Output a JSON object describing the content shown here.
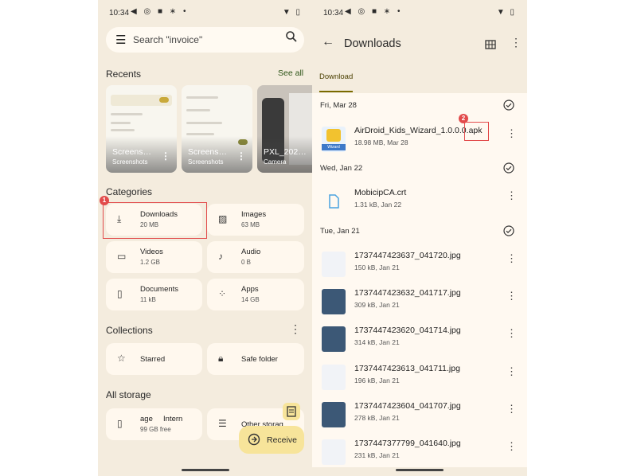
{
  "left": {
    "status": {
      "time": "10:34"
    },
    "search": {
      "placeholder": "Search \"invoice\""
    },
    "recents": {
      "title": "Recents",
      "see_all": "See all",
      "items": [
        {
          "label": "Screens…",
          "sublabel": "Screenshots"
        },
        {
          "label": "Screens…",
          "sublabel": "Screenshots"
        },
        {
          "label": "PXL_202…",
          "sublabel": "Camera"
        }
      ]
    },
    "categories": {
      "title": "Categories",
      "items": [
        {
          "name": "Downloads",
          "size": "20 MB",
          "icon": "download-icon"
        },
        {
          "name": "Images",
          "size": "63 MB",
          "icon": "image-icon"
        },
        {
          "name": "Videos",
          "size": "1.2 GB",
          "icon": "video-icon"
        },
        {
          "name": "Audio",
          "size": "0 B",
          "icon": "music-note-icon"
        },
        {
          "name": "Documents",
          "size": "11 kB",
          "icon": "document-icon"
        },
        {
          "name": "Apps",
          "size": "14 GB",
          "icon": "apps-grid-icon"
        }
      ]
    },
    "collections": {
      "title": "Collections",
      "items": [
        {
          "name": "Starred",
          "icon": "star-icon"
        },
        {
          "name": "Safe folder",
          "icon": "lock-icon"
        }
      ]
    },
    "storage": {
      "title": "All storage",
      "items": [
        {
          "name": "age     Intern",
          "sub": "99 GB free",
          "icon": "phone-icon"
        },
        {
          "name": "Other storag",
          "icon": "list-icon"
        }
      ]
    },
    "receive_label": "Receive",
    "callout_number": "1"
  },
  "right": {
    "status": {
      "time": "10:34"
    },
    "title": "Downloads",
    "tab": "Download",
    "callout_number": "2",
    "groups": [
      {
        "date": "Fri, Mar 28",
        "files": [
          {
            "name": "AirDroid_Kids_Wizard_1.0.0.0.apk",
            "meta": "18.98 MB, Mar 28",
            "kind": "apk",
            "icon_text": "Wizard"
          }
        ]
      },
      {
        "date": "Wed, Jan 22",
        "files": [
          {
            "name": "MobicipCA.crt",
            "meta": "1.31 kB, Jan 22",
            "kind": "cert"
          }
        ]
      },
      {
        "date": "Tue, Jan 21",
        "files": [
          {
            "name": "1737447423637_041720.jpg",
            "meta": "150 kB, Jan 21",
            "kind": "doc"
          },
          {
            "name": "1737447423632_041717.jpg",
            "meta": "309 kB, Jan 21",
            "kind": "img"
          },
          {
            "name": "1737447423620_041714.jpg",
            "meta": "314 kB, Jan 21",
            "kind": "img"
          },
          {
            "name": "1737447423613_041711.jpg",
            "meta": "196 kB, Jan 21",
            "kind": "doc"
          },
          {
            "name": "1737447423604_041707.jpg",
            "meta": "278 kB, Jan 21",
            "kind": "img"
          },
          {
            "name": "1737447377799_041640.jpg",
            "meta": "231 kB, Jan 21",
            "kind": "doc"
          }
        ]
      }
    ]
  },
  "colors": {
    "accent": "#2c5316",
    "background": "#f4ecde",
    "callout": "#e24b4b",
    "fab": "#f7e49a"
  }
}
